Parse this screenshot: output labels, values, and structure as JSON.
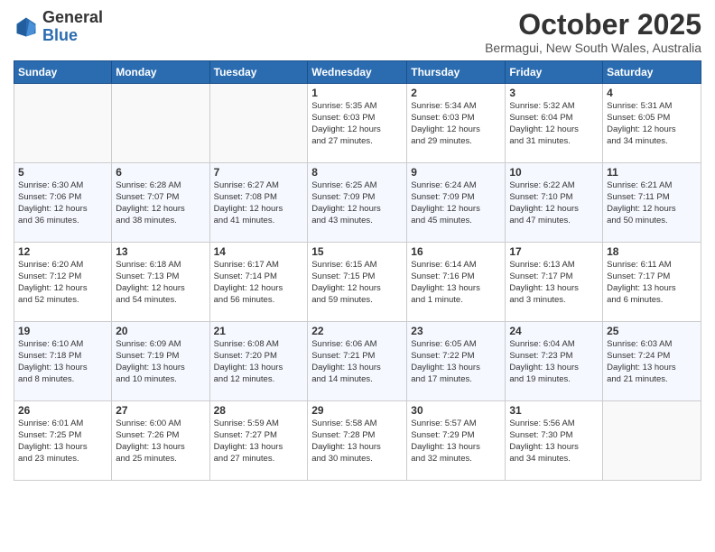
{
  "header": {
    "logo_general": "General",
    "logo_blue": "Blue",
    "month_title": "October 2025",
    "location": "Bermagui, New South Wales, Australia"
  },
  "days_of_week": [
    "Sunday",
    "Monday",
    "Tuesday",
    "Wednesday",
    "Thursday",
    "Friday",
    "Saturday"
  ],
  "weeks": [
    [
      {
        "num": "",
        "info": ""
      },
      {
        "num": "",
        "info": ""
      },
      {
        "num": "",
        "info": ""
      },
      {
        "num": "1",
        "info": "Sunrise: 5:35 AM\nSunset: 6:03 PM\nDaylight: 12 hours\nand 27 minutes."
      },
      {
        "num": "2",
        "info": "Sunrise: 5:34 AM\nSunset: 6:03 PM\nDaylight: 12 hours\nand 29 minutes."
      },
      {
        "num": "3",
        "info": "Sunrise: 5:32 AM\nSunset: 6:04 PM\nDaylight: 12 hours\nand 31 minutes."
      },
      {
        "num": "4",
        "info": "Sunrise: 5:31 AM\nSunset: 6:05 PM\nDaylight: 12 hours\nand 34 minutes."
      }
    ],
    [
      {
        "num": "5",
        "info": "Sunrise: 6:30 AM\nSunset: 7:06 PM\nDaylight: 12 hours\nand 36 minutes."
      },
      {
        "num": "6",
        "info": "Sunrise: 6:28 AM\nSunset: 7:07 PM\nDaylight: 12 hours\nand 38 minutes."
      },
      {
        "num": "7",
        "info": "Sunrise: 6:27 AM\nSunset: 7:08 PM\nDaylight: 12 hours\nand 41 minutes."
      },
      {
        "num": "8",
        "info": "Sunrise: 6:25 AM\nSunset: 7:09 PM\nDaylight: 12 hours\nand 43 minutes."
      },
      {
        "num": "9",
        "info": "Sunrise: 6:24 AM\nSunset: 7:09 PM\nDaylight: 12 hours\nand 45 minutes."
      },
      {
        "num": "10",
        "info": "Sunrise: 6:22 AM\nSunset: 7:10 PM\nDaylight: 12 hours\nand 47 minutes."
      },
      {
        "num": "11",
        "info": "Sunrise: 6:21 AM\nSunset: 7:11 PM\nDaylight: 12 hours\nand 50 minutes."
      }
    ],
    [
      {
        "num": "12",
        "info": "Sunrise: 6:20 AM\nSunset: 7:12 PM\nDaylight: 12 hours\nand 52 minutes."
      },
      {
        "num": "13",
        "info": "Sunrise: 6:18 AM\nSunset: 7:13 PM\nDaylight: 12 hours\nand 54 minutes."
      },
      {
        "num": "14",
        "info": "Sunrise: 6:17 AM\nSunset: 7:14 PM\nDaylight: 12 hours\nand 56 minutes."
      },
      {
        "num": "15",
        "info": "Sunrise: 6:15 AM\nSunset: 7:15 PM\nDaylight: 12 hours\nand 59 minutes."
      },
      {
        "num": "16",
        "info": "Sunrise: 6:14 AM\nSunset: 7:16 PM\nDaylight: 13 hours\nand 1 minute."
      },
      {
        "num": "17",
        "info": "Sunrise: 6:13 AM\nSunset: 7:17 PM\nDaylight: 13 hours\nand 3 minutes."
      },
      {
        "num": "18",
        "info": "Sunrise: 6:11 AM\nSunset: 7:17 PM\nDaylight: 13 hours\nand 6 minutes."
      }
    ],
    [
      {
        "num": "19",
        "info": "Sunrise: 6:10 AM\nSunset: 7:18 PM\nDaylight: 13 hours\nand 8 minutes."
      },
      {
        "num": "20",
        "info": "Sunrise: 6:09 AM\nSunset: 7:19 PM\nDaylight: 13 hours\nand 10 minutes."
      },
      {
        "num": "21",
        "info": "Sunrise: 6:08 AM\nSunset: 7:20 PM\nDaylight: 13 hours\nand 12 minutes."
      },
      {
        "num": "22",
        "info": "Sunrise: 6:06 AM\nSunset: 7:21 PM\nDaylight: 13 hours\nand 14 minutes."
      },
      {
        "num": "23",
        "info": "Sunrise: 6:05 AM\nSunset: 7:22 PM\nDaylight: 13 hours\nand 17 minutes."
      },
      {
        "num": "24",
        "info": "Sunrise: 6:04 AM\nSunset: 7:23 PM\nDaylight: 13 hours\nand 19 minutes."
      },
      {
        "num": "25",
        "info": "Sunrise: 6:03 AM\nSunset: 7:24 PM\nDaylight: 13 hours\nand 21 minutes."
      }
    ],
    [
      {
        "num": "26",
        "info": "Sunrise: 6:01 AM\nSunset: 7:25 PM\nDaylight: 13 hours\nand 23 minutes."
      },
      {
        "num": "27",
        "info": "Sunrise: 6:00 AM\nSunset: 7:26 PM\nDaylight: 13 hours\nand 25 minutes."
      },
      {
        "num": "28",
        "info": "Sunrise: 5:59 AM\nSunset: 7:27 PM\nDaylight: 13 hours\nand 27 minutes."
      },
      {
        "num": "29",
        "info": "Sunrise: 5:58 AM\nSunset: 7:28 PM\nDaylight: 13 hours\nand 30 minutes."
      },
      {
        "num": "30",
        "info": "Sunrise: 5:57 AM\nSunset: 7:29 PM\nDaylight: 13 hours\nand 32 minutes."
      },
      {
        "num": "31",
        "info": "Sunrise: 5:56 AM\nSunset: 7:30 PM\nDaylight: 13 hours\nand 34 minutes."
      },
      {
        "num": "",
        "info": ""
      }
    ]
  ]
}
